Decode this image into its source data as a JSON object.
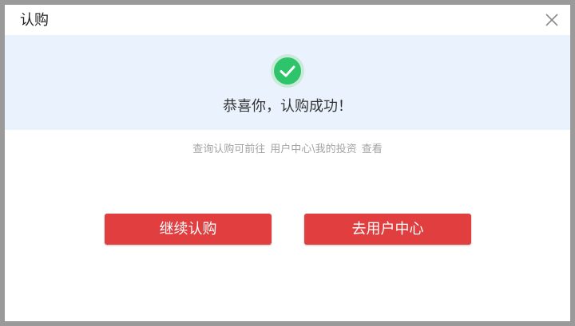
{
  "dialog": {
    "title": "认购",
    "close_icon": "close-icon"
  },
  "success": {
    "icon": "check-circle-icon",
    "icon_color": "#2ec46b",
    "message": "恭喜你，认购成功！"
  },
  "hint": {
    "prefix": "查询认购可前往",
    "link": "用户中心\\我的投资",
    "suffix": "查看"
  },
  "actions": {
    "continue_label": "继续认购",
    "user_center_label": "去用户中心",
    "button_color": "#e03e3f"
  }
}
